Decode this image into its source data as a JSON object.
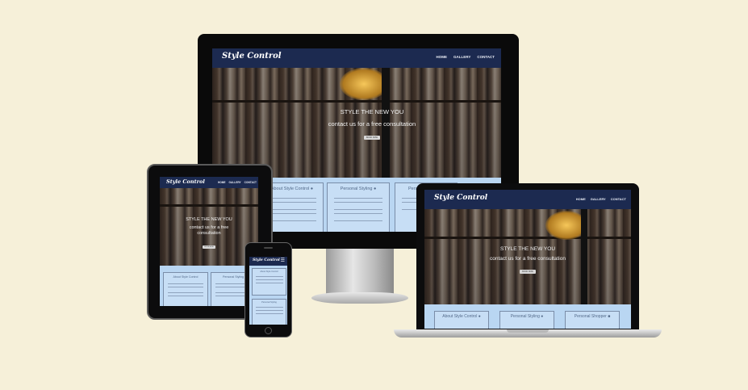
{
  "site": {
    "brand": "Style Control",
    "nav": {
      "home": "HOME",
      "gallery": "GALLERY",
      "contact": "CONTACT"
    },
    "hero": {
      "headline": "STYLE THE NEW YOU",
      "subline": "contact us for a free consultation",
      "button": "BOOK NOW"
    },
    "cards": {
      "about": "About Style Control",
      "styling": "Personal Styling",
      "shopper": "Personal Shopper"
    }
  },
  "icons": {
    "menu": "hamburger-menu-icon",
    "user": "user-icon",
    "bag": "shopping-bag-icon"
  },
  "colors": {
    "page_background": "#f6f0d9",
    "nav": "#1c2a50",
    "content": "#b9d6f2",
    "card_border": "#7a8da8"
  }
}
